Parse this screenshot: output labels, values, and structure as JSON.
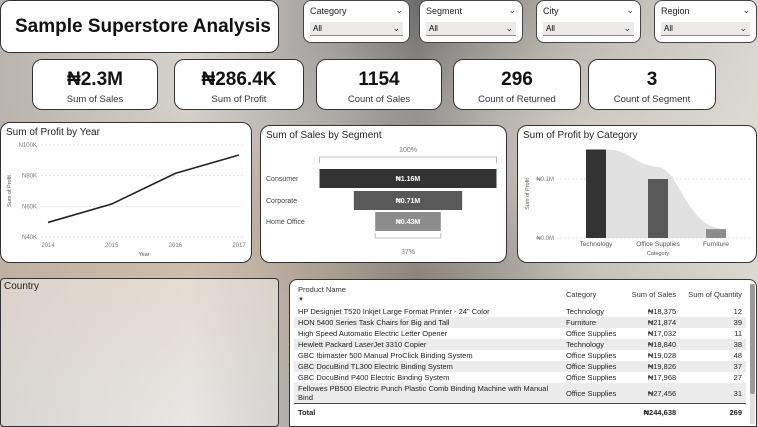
{
  "dashboard_title": "Sample Superstore Analysis",
  "slicers": [
    {
      "label": "Category",
      "value": "All"
    },
    {
      "label": "Segment",
      "value": "All"
    },
    {
      "label": "City",
      "value": "All"
    },
    {
      "label": "Region",
      "value": "All"
    }
  ],
  "kpis": [
    {
      "value": "₦2.3M",
      "caption": "Sum of Sales"
    },
    {
      "value": "₦286.4K",
      "caption": "Sum of Profit"
    },
    {
      "value": "1154",
      "caption": "Count of Sales"
    },
    {
      "value": "296",
      "caption": "Count of Returned"
    },
    {
      "value": "3",
      "caption": "Count of Segment"
    }
  ],
  "icons": {
    "slicer_chevron": "chevron-down-icon",
    "sort": "sort-down-icon"
  },
  "colors": {
    "dark_bar": "#333333",
    "mid_bar": "#595959",
    "light_bar": "#8c8c8c",
    "line": "#222222"
  },
  "chart_data": [
    {
      "type": "line",
      "title": "Sum of Profit by Year",
      "xlabel": "Year",
      "ylabel": "Sum of Profit",
      "x": [
        "2014",
        "2015",
        "2016",
        "2017"
      ],
      "values": [
        49500,
        61500,
        81500,
        93500
      ],
      "ylim": [
        40000,
        100000
      ],
      "yticks": [
        "N100K",
        "N80K",
        "N60K",
        "N40K"
      ],
      "ytick_values": [
        100000,
        80000,
        60000,
        40000
      ]
    },
    {
      "type": "bar",
      "title": "Sum of Sales by Segment",
      "categories": [
        "Consumer",
        "Corporate",
        "Home Office"
      ],
      "values": [
        1.16,
        0.71,
        0.43
      ],
      "data_labels": [
        "₦1.16M",
        "₦0.71M",
        "₦0.43M"
      ],
      "top_label": "100%",
      "bottom_label": "37%"
    },
    {
      "type": "bar",
      "title": "Sum of Profit by Category",
      "xlabel": "Category",
      "ylabel": "Sum of Profit",
      "categories": [
        "Technology",
        "Office Supplies",
        "Furniture"
      ],
      "values": [
        1.5,
        1.0,
        0.15
      ],
      "yticks": [
        "₦0.1M",
        "₦0.0M"
      ],
      "ytick_values": [
        1.0,
        0.0
      ]
    }
  ],
  "country_title": "Country",
  "table": {
    "headers": [
      "Product Name",
      "Category",
      "Sum of Sales",
      "Sum of Quantity"
    ],
    "rows": [
      [
        "HP Designjet T520 Inkjet Large Format Printer - 24\" Color",
        "Technology",
        "₦18,375",
        "12"
      ],
      [
        "HON 5400 Series Task Chairs for Big and Tall",
        "Furniture",
        "₦21,874",
        "39"
      ],
      [
        "High Speed Automatic Electric Letter Opener",
        "Office Supplies",
        "₦17,032",
        "11"
      ],
      [
        "Hewlett Packard LaserJet 3310 Copier",
        "Technology",
        "₦18,840",
        "38"
      ],
      [
        "GBC Ibimaster 500 Manual ProClick Binding System",
        "Office Supplies",
        "₦19,028",
        "48"
      ],
      [
        "GBC DocuBind TL300 Electric Binding System",
        "Office Supplies",
        "₦19,826",
        "37"
      ],
      [
        "GBC DocuBind P400 Electric Binding System",
        "Office Supplies",
        "₦17,968",
        "27"
      ],
      [
        "Fellowes PB500 Electric Punch Plastic Comb Binding Machine with Manual Bind",
        "Office Supplies",
        "₦27,456",
        "31"
      ]
    ],
    "total": [
      "Total",
      "",
      "₦244,638",
      "269"
    ]
  }
}
